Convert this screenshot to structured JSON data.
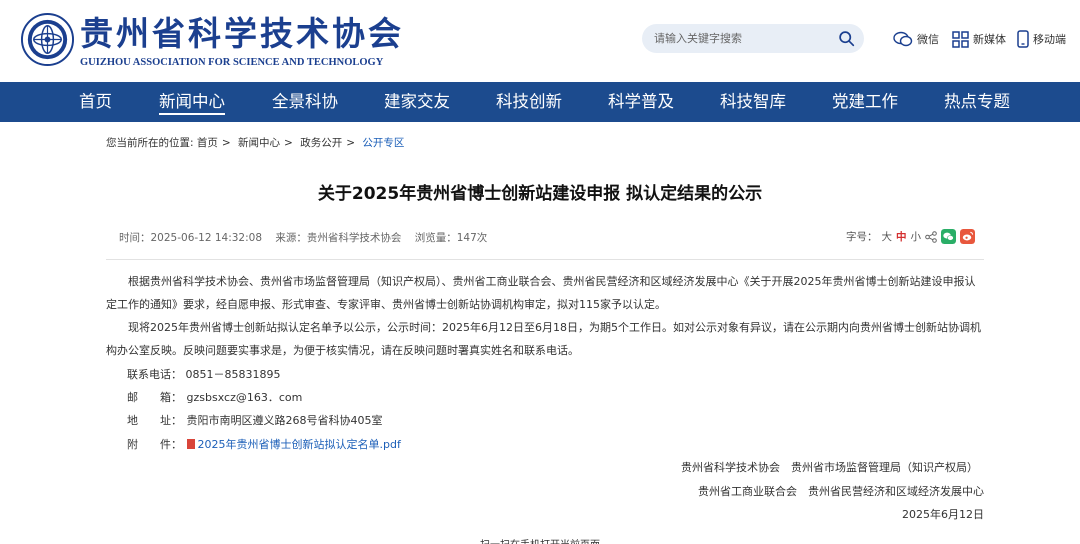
{
  "header": {
    "logo_cn": "贵州省科学技术协会",
    "logo_en": "GUIZHOU ASSOCIATION FOR SCIENCE AND TECHNOLOGY",
    "search_placeholder": "请输入关键字搜索",
    "links": {
      "wechat": "微信",
      "media": "新媒体",
      "mobile": "移动端"
    }
  },
  "nav": {
    "items": [
      "首页",
      "新闻中心",
      "全景科协",
      "建家交友",
      "科技创新",
      "科学普及",
      "科技智库",
      "党建工作",
      "热点专题"
    ],
    "active": "新闻中心"
  },
  "breadcrumb": {
    "prefix": "您当前所在的位置:",
    "items": [
      "首页",
      "新闻中心",
      "政务公开",
      "公开专区"
    ]
  },
  "article": {
    "title": "关于2025年贵州省博士创新站建设申报 拟认定结果的公示",
    "time": "时间：2025-06-12 14:32:08",
    "source": "来源：贵州省科学技术协会",
    "views": "浏览量：147次",
    "fontsize": {
      "label": "字号：",
      "large": "大",
      "medium": "中",
      "small": "小"
    },
    "para1": "根据贵州省科学技术协会、贵州省市场监督管理局（知识产权局）、贵州省工商业联合会、贵州省民营经济和区域经济发展中心《关于开展2025年贵州省博士创新站建设申报认定工作的通知》要求，经自愿申报、形式审查、专家评审、贵州省博士创新站协调机构审定，拟对115家予以认定。",
    "para2": "现将2025年贵州省博士创新站拟认定名单予以公示，公示时间：2025年6月12日至6月18日，为期5个工作日。如对公示对象有异议，请在公示期内向贵州省博士创新站协调机构办公室反映。反映问题要实事求是，为便于核实情况，请在反映问题时署真实姓名和联系电话。",
    "phone_label": "联系电话：",
    "phone": "0851－85831895",
    "email_label": "邮　　箱：",
    "email": "gzsbsxcz@163．com",
    "address_label": "地　　址：",
    "address": "贵阳市南明区遵义路268号省科协405室",
    "attach_label": "附　　件：",
    "attach": "2025年贵州省博士创新站拟认定名单.pdf",
    "sig1": "贵州省科学技术协会　贵州省市场监督管理局（知识产权局）",
    "sig2": "贵州省工商业联合会　贵州省民营经济和区域经济发展中心",
    "date": "2025年6月12日",
    "qr_hint": "扫一扫在手机打开当前页面"
  },
  "colors": {
    "nav_bg": "#1c4b8e",
    "brand": "#1b3f8f",
    "link": "#1c5fb8",
    "highlight": "#d43030"
  }
}
